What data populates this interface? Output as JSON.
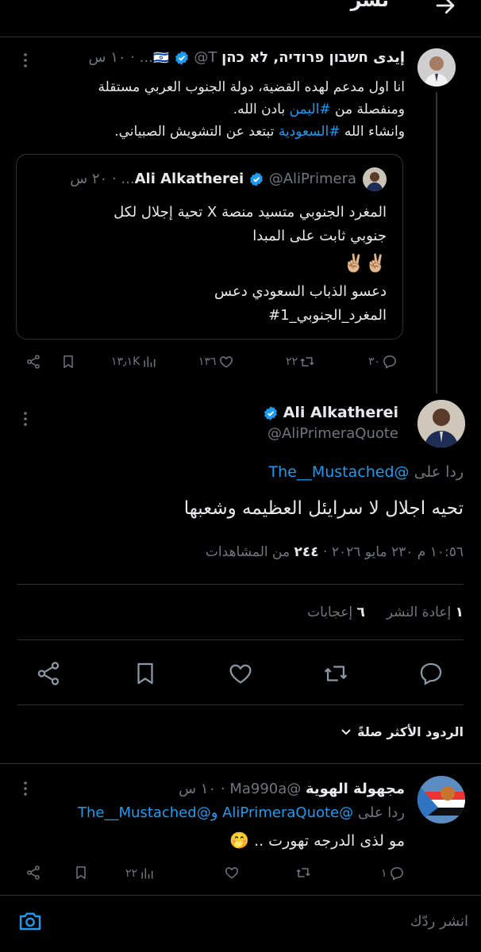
{
  "header": {
    "title": "نشر"
  },
  "parent_tweet": {
    "name": "إيدى חשבון פרודיה, לא כהן",
    "flag": "🇮🇱",
    "handle": "@T...",
    "time": "١٠ س",
    "line1": "انا اول مدعم لهده القضية، دولة الجنوب العربي مستقلة",
    "line2_a": "ومنفصلة من ",
    "line2_tag": "#اليمن",
    "line2_b": " بادن الله.",
    "line3_a": "وانشاء الله ",
    "line3_tag": "#السعودية",
    "line3_b": " تبتعد عن التشويش الصبياني.",
    "quote": {
      "name": "Ali Alkatherei",
      "handle": "@AliPrimera...",
      "time": "٢٠ س",
      "line1": "المغرد الجنوبي متسيد منصة X تحية إجلال لكل",
      "line2": "جنوبي ثابت على المبدا",
      "emoji": "✌🏼✌🏼",
      "line3": "دعسو الذباب السعودي دعس",
      "line4": "المغرد_الجنوبي_1#"
    },
    "stats": {
      "replies": "٣٠",
      "reposts": "٢٢",
      "likes": "١٣٦",
      "views": "١٣٫١K"
    }
  },
  "main_tweet": {
    "name": "Ali Alkatherei",
    "handle": "@AliPrimeraQuote",
    "reply_to_label": "ردا على",
    "reply_to": "@The__Mustached",
    "text": "تحيه اجلال لا سرايئل العظيمه وشعبها",
    "meta_time": "١٠:٥٦ م ٢٣٠ مايو ٢٠٢٦",
    "meta_views": "٢٤٤",
    "meta_views_label": "من المشاهدات",
    "reposts_count": "١",
    "reposts_label": "إعادة النشر",
    "likes_count": "٦",
    "likes_label": "إعجابات"
  },
  "sort": {
    "label": "الردود الأكثر صلةً"
  },
  "reply": {
    "name": "مجهولة الهوية",
    "handle": "@Ma990a",
    "time": "١٠ س",
    "reply_label": "ردا على",
    "mention1": "@AliPrimeraQuote",
    "and": " و",
    "mention2": "@The__Mustached",
    "text": "مو لذى الدرجه تهورت ..",
    "emoji": "🤭",
    "stats": {
      "replies": "١",
      "views": "٢٢"
    }
  },
  "composer": {
    "placeholder": "انشر ردّك"
  },
  "colors": {
    "accent": "#1d9bf0",
    "background": "#000000",
    "muted": "#71767b",
    "divider": "#2f3336"
  },
  "icons": [
    "back-arrow-icon",
    "more-icon",
    "verified-icon",
    "reply-icon",
    "repost-icon",
    "like-icon",
    "views-icon",
    "bookmark-icon",
    "share-icon",
    "chevron-down-icon",
    "camera-icon"
  ]
}
